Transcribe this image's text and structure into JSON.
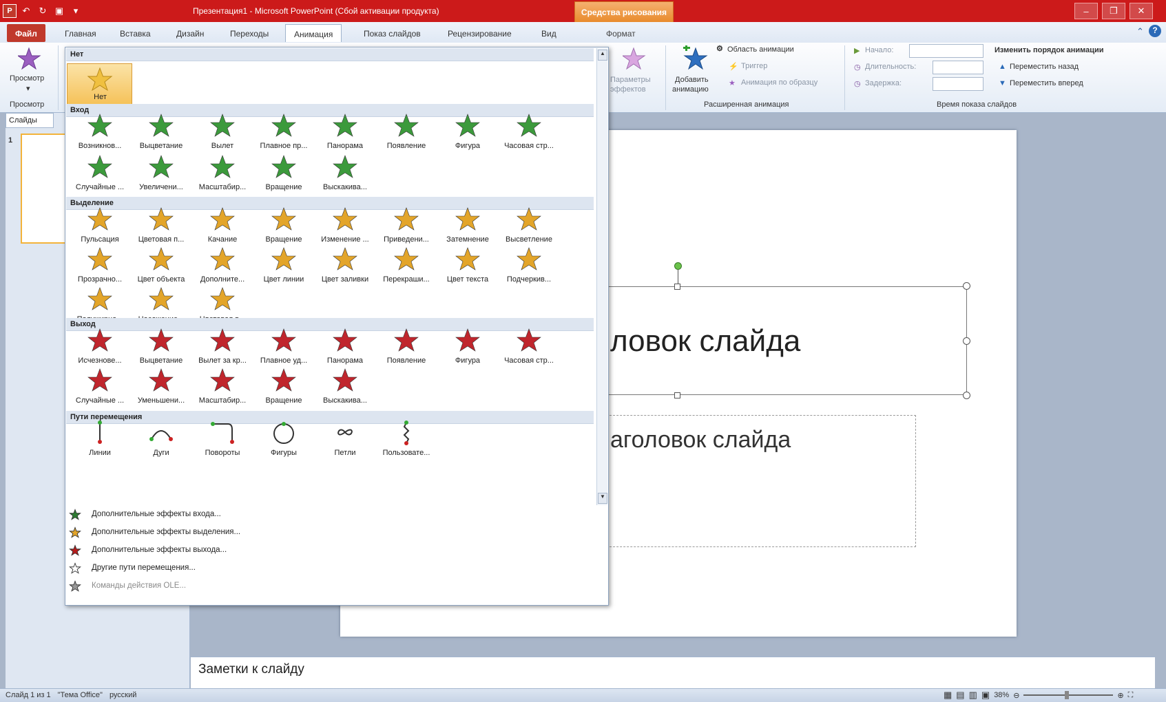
{
  "window": {
    "title": "Презентация1 - Microsoft PowerPoint (Сбой активации продукта)",
    "context_group": "Средства рисования"
  },
  "tabs": [
    {
      "label": "Файл"
    },
    {
      "label": "Главная"
    },
    {
      "label": "Вставка"
    },
    {
      "label": "Дизайн"
    },
    {
      "label": "Переходы"
    },
    {
      "label": "Анимация"
    },
    {
      "label": "Показ слайдов"
    },
    {
      "label": "Рецензирование"
    },
    {
      "label": "Вид"
    },
    {
      "label": "Формат"
    }
  ],
  "ribbon": {
    "preview_label": "Просмотр",
    "preview_group": "Просмотр",
    "effect_params": [
      "Параметры",
      "эффектов"
    ],
    "add_animation": [
      "Добавить",
      "анимацию"
    ],
    "animation_pane": "Область анимации",
    "trigger": "Триггер",
    "animation_painter": "Анимация по образцу",
    "adv_group": "Расширенная анимация",
    "start": "Начало:",
    "duration": "Длительность:",
    "delay": "Задержка:",
    "reorder": "Изменить порядок анимации",
    "move_earlier": "Переместить назад",
    "move_later": "Переместить вперед",
    "timing_group": "Время показа слайдов"
  },
  "leftpane": {
    "tab": "Слайды",
    "slide_num": "1"
  },
  "slide": {
    "title": "ловок слайда",
    "subtitle": "аголовок слайда"
  },
  "notes": "Заметки к слайду",
  "status": {
    "slide": "Слайд 1 из 1",
    "theme": "\"Тема Office\"",
    "lang": "русский",
    "zoom": "38%"
  },
  "gallery": {
    "none_header": "Нет",
    "none_item": "Нет",
    "sections": [
      {
        "title": "Вход",
        "color": "#3c9a3c",
        "items": [
          "Возникнов...",
          "Выцветание",
          "Вылет",
          "Плавное пр...",
          "Панорама",
          "Появление",
          "Фигура",
          "Часовая стр...",
          "Случайные ...",
          "Увеличени...",
          "Масштабир...",
          "Вращение",
          "Выскакива..."
        ]
      },
      {
        "title": "Выделение",
        "color": "#e3a52a",
        "items": [
          "Пульсация",
          "Цветовая п...",
          "Качание",
          "Вращение",
          "Изменение ...",
          "Приведени...",
          "Затемнение",
          "Высветление",
          "Прозрачно...",
          "Цвет объекта",
          "Дополните...",
          "Цвет линии",
          "Цвет заливки",
          "Перекраши...",
          "Цвет текста",
          "Подчеркив...",
          "Полужирно...",
          "Насожение...",
          "Цветовая в..."
        ]
      },
      {
        "title": "Выход",
        "color": "#c0262d",
        "items": [
          "Исчезнове...",
          "Выцветание",
          "Вылет за кр...",
          "Плавное уд...",
          "Панорама",
          "Появление",
          "Фигура",
          "Часовая стр...",
          "Случайные ...",
          "Уменьшени...",
          "Масштабир...",
          "Вращение",
          "Выскакива..."
        ]
      },
      {
        "title": "Пути перемещения",
        "color": "#555555",
        "items": [
          "Линии",
          "Дуги",
          "Повороты",
          "Фигуры",
          "Петли",
          "Пользовате..."
        ]
      }
    ],
    "more": [
      {
        "label": "Дополнительные эффекты входа...",
        "icon": "green-star-icon",
        "color": "#2e7d32"
      },
      {
        "label": "Дополнительные эффекты выделения...",
        "icon": "yellow-star-icon",
        "color": "#e3a52a"
      },
      {
        "label": "Дополнительные эффекты выхода...",
        "icon": "red-star-icon",
        "color": "#b71c1c"
      },
      {
        "label": "Другие пути перемещения...",
        "icon": "outline-star-icon",
        "color": "#444444"
      },
      {
        "label": "Команды действия OLE...",
        "icon": "ole-icon",
        "color": "#999999",
        "disabled": true
      }
    ]
  }
}
